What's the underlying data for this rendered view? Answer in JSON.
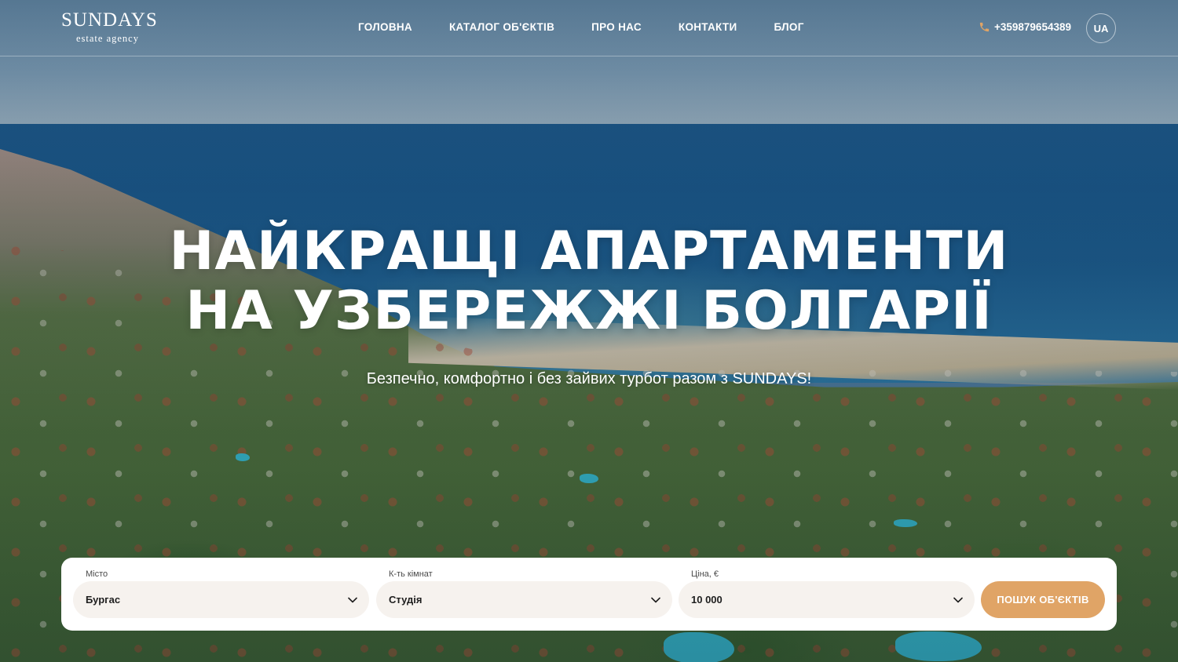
{
  "brand": {
    "name": "SUNDAYS",
    "tagline": "estate agency"
  },
  "nav": {
    "items": [
      {
        "label": "ГОЛОВНА"
      },
      {
        "label": "КАТАЛОГ ОБ'ЄКТІВ"
      },
      {
        "label": "ПРО НАС"
      },
      {
        "label": "КОНТАКТИ"
      },
      {
        "label": "БЛОГ"
      }
    ]
  },
  "header": {
    "phone": "+359879654389",
    "phone_icon": "phone-icon",
    "language": "UA"
  },
  "hero": {
    "title_line1": "НАЙКРАЩІ АПАРТАМЕНТИ",
    "title_line2": "НА УЗБЕРЕЖЖІ БОЛГАРІЇ",
    "subtitle": "Безпечно, комфортно і без зайвих турбот разом з SUNDAYS!"
  },
  "search": {
    "city": {
      "label": "Місто",
      "value": "Бургас"
    },
    "rooms": {
      "label": "К-ть кімнат",
      "value": "Студія"
    },
    "price": {
      "label": "Ціна, €",
      "value": "10 000"
    },
    "button_label": "ПОШУК ОБ'ЄКТІВ"
  },
  "colors": {
    "accent": "#e0a466",
    "field_bg": "#f6f2ee",
    "panel_bg": "#ffffff"
  }
}
